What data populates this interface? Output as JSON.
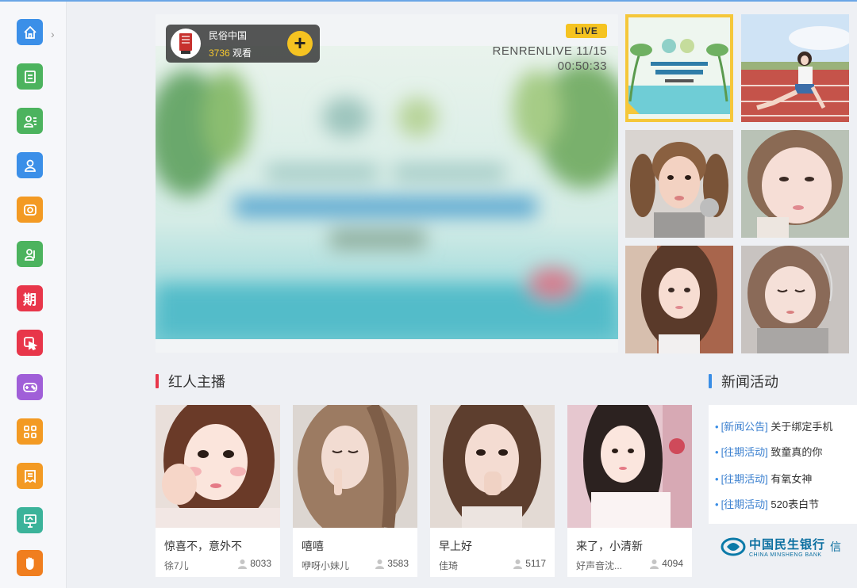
{
  "sidebar": {
    "items": [
      {
        "icon": "home-icon",
        "color": "#3b8fe8"
      },
      {
        "icon": "list-icon",
        "color": "#4cb35e"
      },
      {
        "icon": "profile-icon",
        "color": "#4cb35e"
      },
      {
        "icon": "user-icon",
        "color": "#3b8fe8"
      },
      {
        "icon": "camera-icon",
        "color": "#f39a23"
      },
      {
        "icon": "contacts-icon",
        "color": "#4cb35e"
      },
      {
        "icon": "period-icon",
        "color": "#e8364a",
        "glyph": "期"
      },
      {
        "icon": "touch-icon",
        "color": "#e8364a"
      },
      {
        "icon": "gamepad-icon",
        "color": "#a05fd8"
      },
      {
        "icon": "apps-icon",
        "color": "#f39a23"
      },
      {
        "icon": "document-icon",
        "color": "#f39a23"
      },
      {
        "icon": "presentation-icon",
        "color": "#3bb39a"
      },
      {
        "icon": "hand-icon",
        "color": "#f07e1f"
      }
    ]
  },
  "hero": {
    "anchor_name": "民俗中国",
    "viewers_count": "3736",
    "viewers_suffix": " 观看",
    "follow_symbol": "+",
    "live_label": "LIVE",
    "stamp_line1": "RENRENLIVE 11/15",
    "stamp_line2": "00:50:33"
  },
  "thumbnails": [
    {
      "name": "thumb-event-banner",
      "active": true
    },
    {
      "name": "thumb-girl-running-track",
      "active": false
    },
    {
      "name": "thumb-girl-pigtails",
      "active": false
    },
    {
      "name": "thumb-girl-closeup",
      "active": false
    },
    {
      "name": "thumb-girl-long-hair",
      "active": false
    },
    {
      "name": "thumb-girl-eyes-closed",
      "active": false
    }
  ],
  "sections": {
    "hot_streamers": "红人主播",
    "news": "新闻活动"
  },
  "cards": [
    {
      "title": "惊喜不，意外不",
      "user": "徐7儿",
      "count": "8033"
    },
    {
      "title": "嘻嘻",
      "user": "咿呀小妹儿",
      "count": "3583"
    },
    {
      "title": "早上好",
      "user": "佳琦",
      "count": "5117"
    },
    {
      "title": "来了，小清新",
      "user": "好声音沈...",
      "count": "4094"
    }
  ],
  "news": [
    {
      "category": "[新闻公告]",
      "text": " 关于绑定手机"
    },
    {
      "category": "[往期活动]",
      "text": " 致童真的你"
    },
    {
      "category": "[往期活动]",
      "text": " 有氧女神"
    },
    {
      "category": "[往期活动]",
      "text": " 520表白节"
    }
  ],
  "bank": {
    "name_cn": "中国民生银行",
    "name_en": "CHINA MINSHENG BANK",
    "suffix": "信"
  },
  "colors": {
    "accent_yellow": "#f5c321",
    "section_bar_red": "#e8364a",
    "section_bar_blue": "#3a8ee6"
  }
}
